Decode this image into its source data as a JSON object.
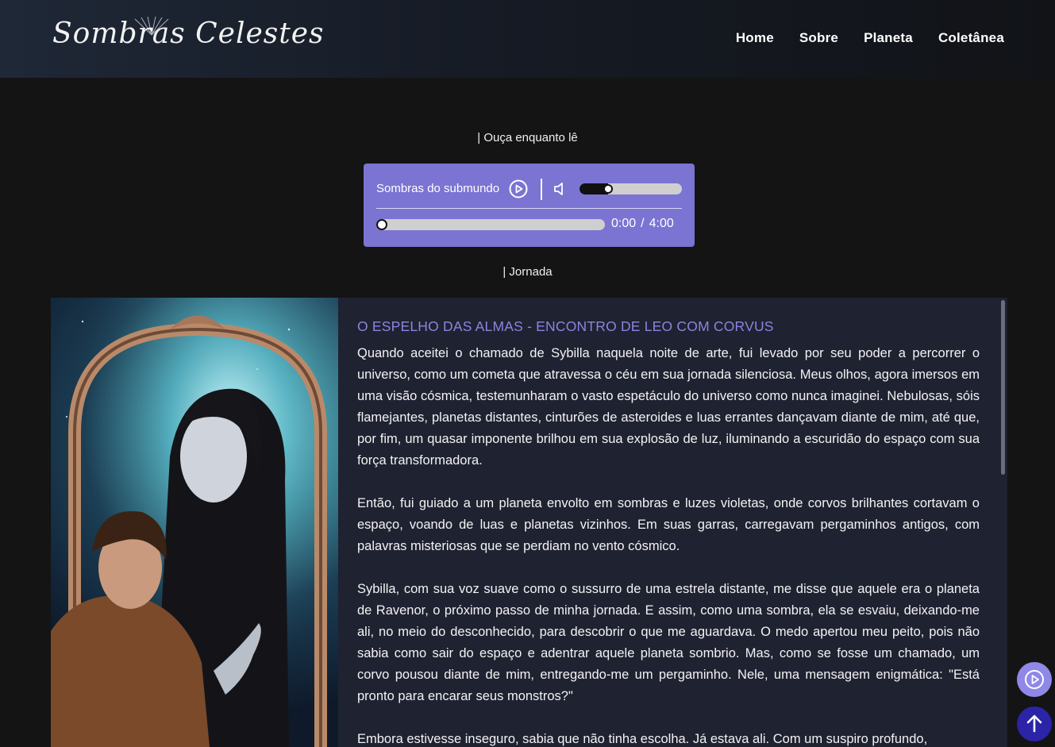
{
  "header": {
    "logo_text": "Sombras Celestes",
    "nav": [
      "Home",
      "Sobre",
      "Planeta",
      "Coletânea"
    ]
  },
  "listen_label": "| Ouça enquanto lê",
  "player": {
    "track_title": "Sombras do submundo",
    "volume_level": 0.28,
    "progress": 0,
    "current_time": "0:00",
    "time_separator": "/",
    "duration": "4:00",
    "accent_color": "#7b74d3"
  },
  "journey_label": "| Jornada",
  "story": {
    "title": "O ESPELHO DAS ALMAS - ENCONTRO DE LEO COM CORVUS",
    "paragraphs": [
      "Quando aceitei o chamado de Sybilla naquela noite de arte, fui levado por seu poder a percorrer o universo, como um cometa que atravessa o céu em sua jornada silenciosa. Meus olhos, agora imersos em uma visão cósmica, testemunharam o vasto espetáculo do universo como nunca imaginei. Nebulosas, sóis flamejantes, planetas distantes, cinturões de asteroides e luas errantes dançavam diante de mim, até que, por fim, um quasar imponente brilhou em sua explosão de luz, iluminando a escuridão do espaço com sua força transformadora.",
      "Então, fui guiado a um planeta envolto em sombras e luzes violetas, onde corvos brilhantes cortavam o espaço, voando de luas e planetas vizinhos. Em suas garras, carregavam pergaminhos antigos, com palavras misteriosas que se perdiam no vento cósmico.",
      "Sybilla, com sua voz suave como o sussurro de uma estrela distante, me disse que aquele era o planeta de Ravenor, o próximo passo de minha jornada. E assim, como uma sombra, ela se esvaiu, deixando-me ali, no meio do desconhecido, para descobrir o que me aguardava. O medo apertou meu peito, pois não sabia como sair do espaço e adentrar aquele planeta sombrio. Mas, como se fosse um chamado, um corvo pousou diante de mim, entregando-me um pergaminho. Nele, uma mensagem enigmática: \"Está pronto para encarar seus monstros?\"",
      "Embora estivesse inseguro, sabia que não tinha escolha. Já estava ali. Com um suspiro profundo,"
    ],
    "title_color": "#8a85e0"
  },
  "icons": {
    "play": "play-circle-icon",
    "mute": "speaker-muted-icon",
    "scroll_top": "arrow-up-icon"
  }
}
